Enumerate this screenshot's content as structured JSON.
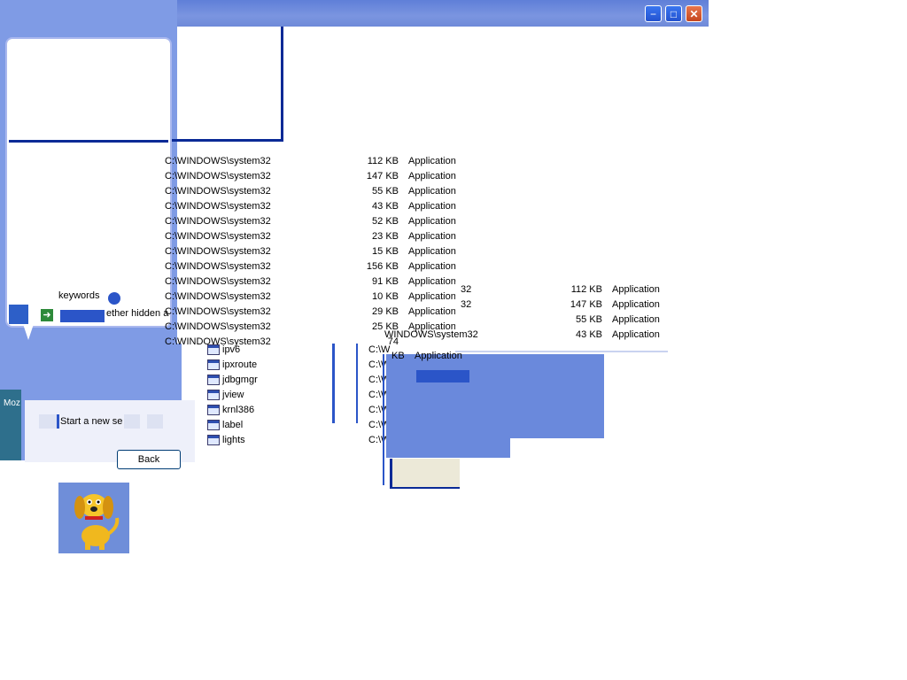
{
  "window": {
    "minimize_glyph": "−",
    "maximize_glyph": "□",
    "close_glyph": "✕"
  },
  "assistant": {
    "keywords_text": "keywords",
    "hidden_text": "ether hidden a",
    "start_search": "Start a new se",
    "back_button": "Back",
    "taskbar_fragment": "Moz"
  },
  "files": {
    "rows": [
      {
        "path": "C:\\WINDOWS\\system32",
        "size": "112 KB",
        "type": "Application"
      },
      {
        "path": "C:\\WINDOWS\\system32",
        "size": "147 KB",
        "type": "Application"
      },
      {
        "path": "C:\\WINDOWS\\system32",
        "size": "55 KB",
        "type": "Application"
      },
      {
        "path": "C:\\WINDOWS\\system32",
        "size": "43 KB",
        "type": "Application"
      },
      {
        "path": "C:\\WINDOWS\\system32",
        "size": "52 KB",
        "type": "Application"
      },
      {
        "path": "C:\\WINDOWS\\system32",
        "size": "23 KB",
        "type": "Application"
      },
      {
        "path": "C:\\WINDOWS\\system32",
        "size": "15 KB",
        "type": "Application"
      },
      {
        "path": "C:\\WINDOWS\\system32",
        "size": "156 KB",
        "type": "Application"
      },
      {
        "path": "C:\\WINDOWS\\system32",
        "size": "91 KB",
        "type": "Application"
      },
      {
        "path": "C:\\WINDOWS\\system32",
        "size": "10 KB",
        "type": "Application"
      },
      {
        "path": "C:\\WINDOWS\\system32",
        "size": "29 KB",
        "type": "Application"
      },
      {
        "path": "C:\\WINDOWS\\system32",
        "size": "25 KB",
        "type": "Application"
      },
      {
        "path": "C:\\WINDOWS\\system32",
        "size": "74",
        "type": ""
      }
    ],
    "icon_items": [
      "ipv6",
      "ipxroute",
      "jdbgmgr",
      "jview",
      "krnl386",
      "label",
      "lights"
    ],
    "path_prefix": "C:\\W"
  },
  "fragment": {
    "rows": [
      {
        "path": "32",
        "size": "112 KB",
        "type": "Application"
      },
      {
        "path": "32",
        "size": "147 KB",
        "type": "Application"
      },
      {
        "path": "",
        "size": "55 KB",
        "type": "Application"
      },
      {
        "path": "WINDOWS\\system32",
        "size": "43 KB",
        "type": "Application"
      }
    ],
    "kb_text": "KB",
    "app_text": "Application"
  },
  "colors": {
    "xp_blue": "#7f9be5",
    "title_blue": "#5f7fd8",
    "dark_blue": "#0a2a96"
  }
}
